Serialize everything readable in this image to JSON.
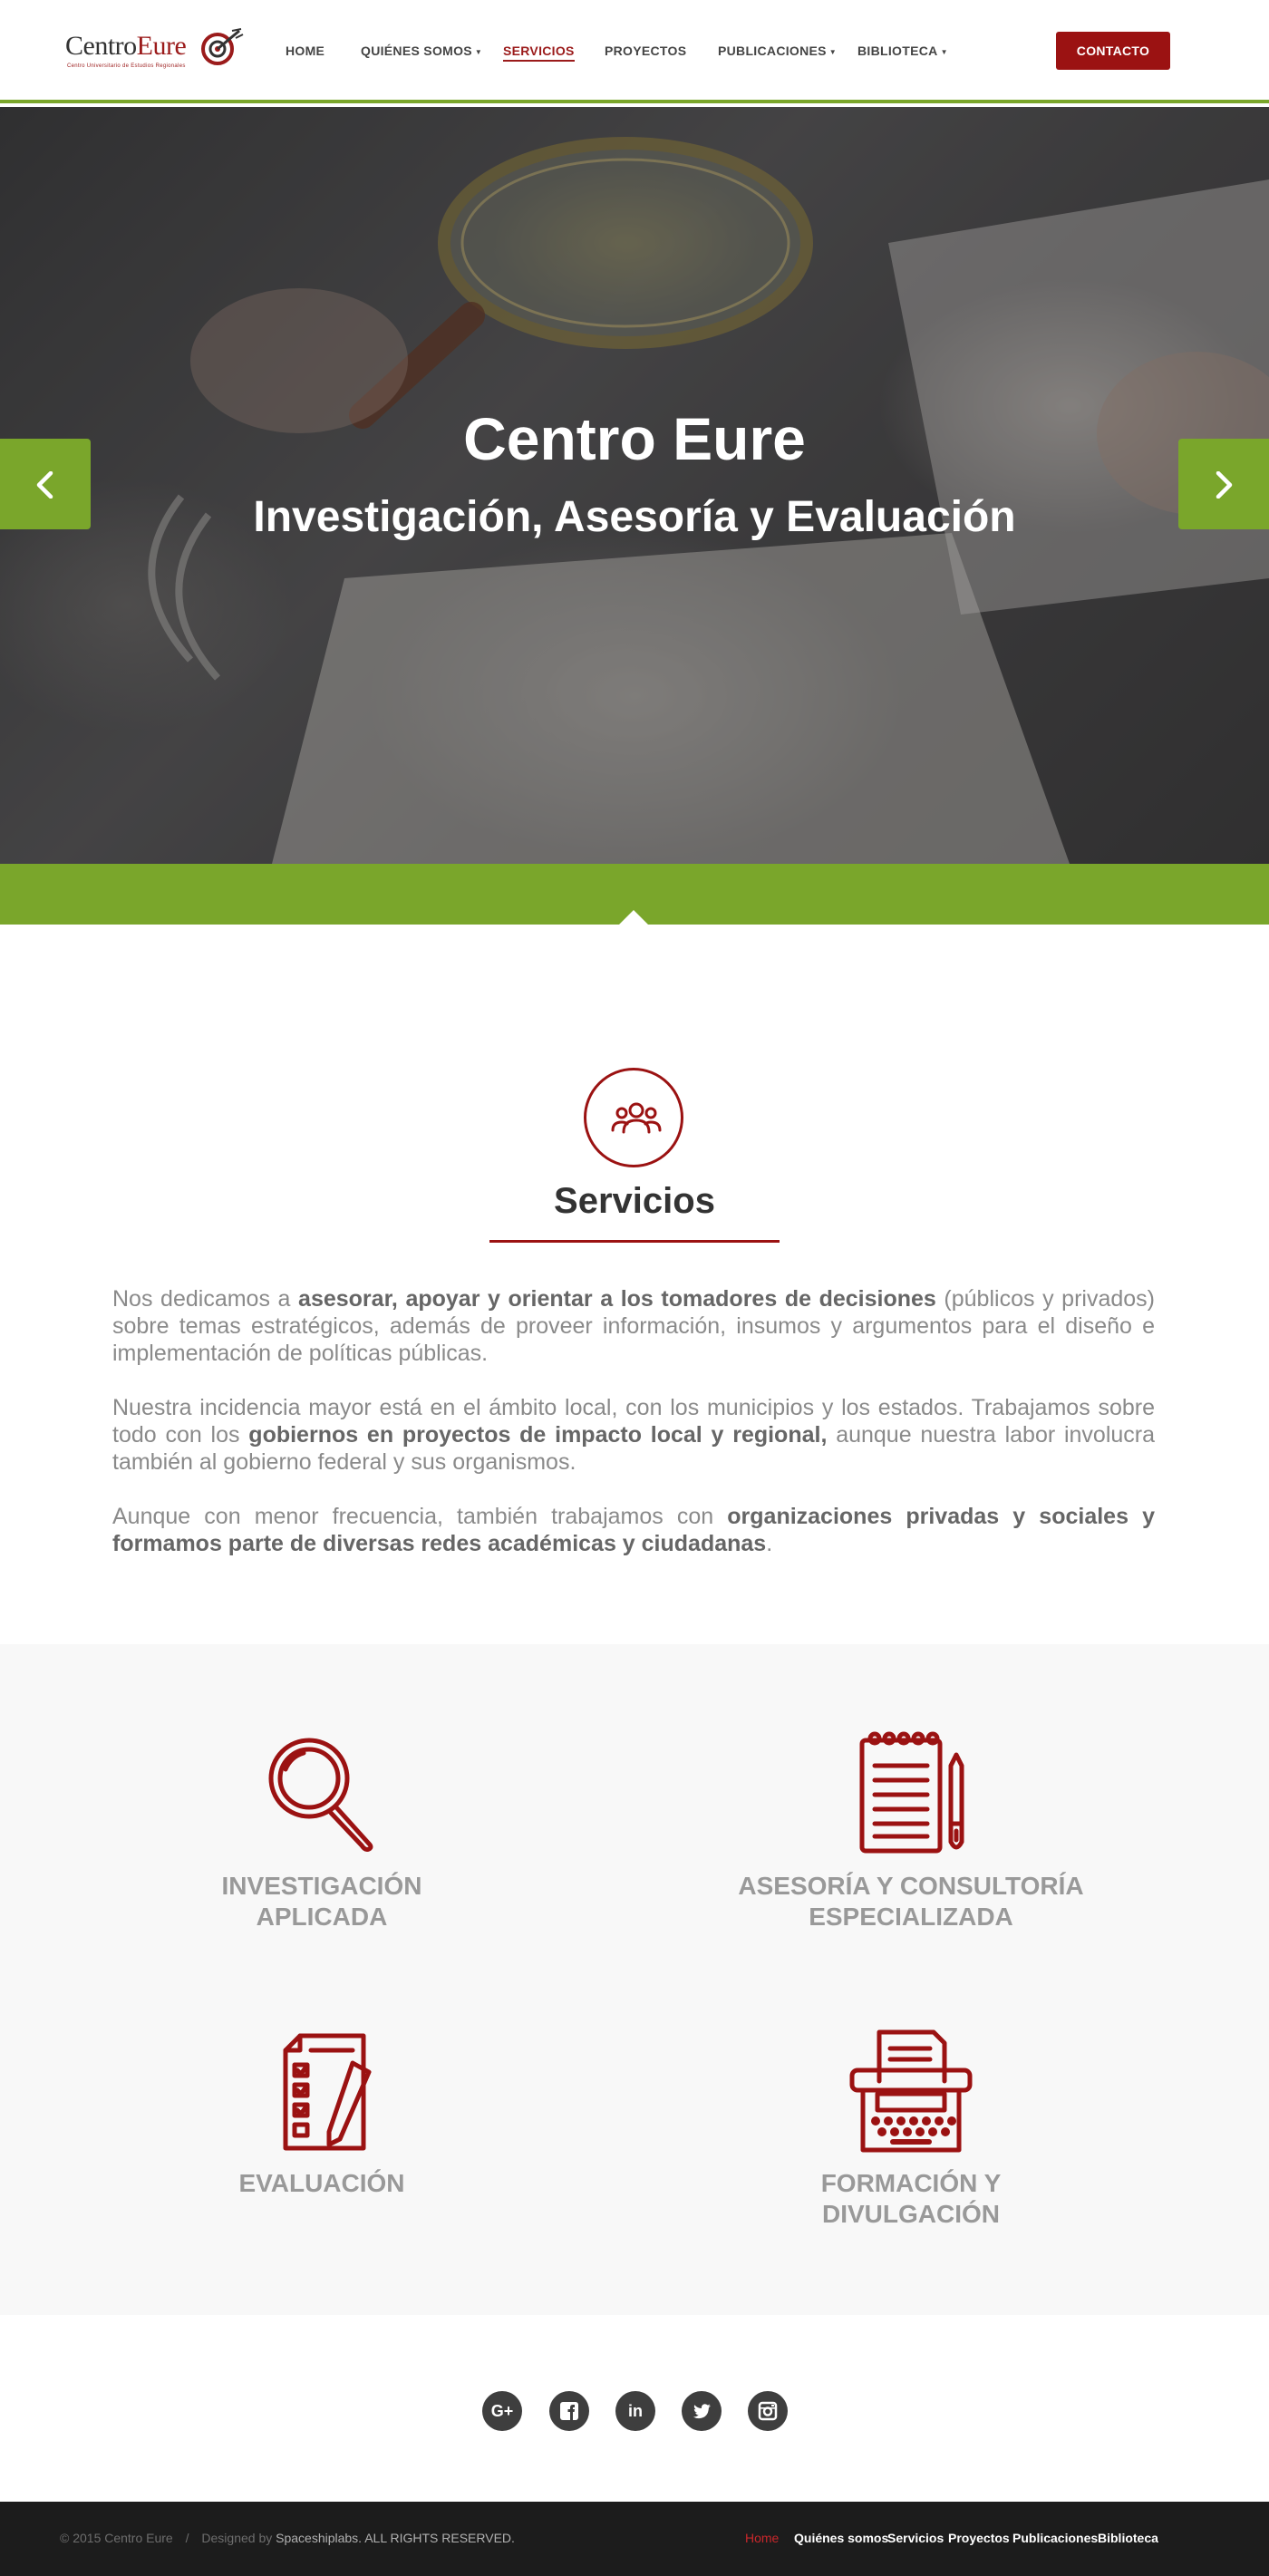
{
  "header": {
    "logo_text_a": "Centro",
    "logo_text_b": "Eure",
    "logo_sub": "Centro Universitario de Estudios Regionales",
    "nav": [
      {
        "label": "HOME",
        "dropdown": false,
        "active": false
      },
      {
        "label": "QUIÉNES SOMOS",
        "dropdown": true,
        "active": false
      },
      {
        "label": "SERVICIOS",
        "dropdown": false,
        "active": true
      },
      {
        "label": "PROYECTOS",
        "dropdown": false,
        "active": false
      },
      {
        "label": "PUBLICACIONES",
        "dropdown": true,
        "active": false
      },
      {
        "label": "BIBLIOTECA",
        "dropdown": true,
        "active": false
      }
    ],
    "contact_label": "CONTACTO"
  },
  "hero": {
    "title": "Centro Eure",
    "subtitle": "Investigación, Asesoría y Evaluación",
    "prev_icon": "chevron-left-icon",
    "next_icon": "chevron-right-icon"
  },
  "services_intro": {
    "icon": "people-group-icon",
    "heading": "Servicios",
    "p1": [
      {
        "t": "Nos dedicamos a ",
        "b": false
      },
      {
        "t": "asesorar, apoyar y orientar a los tomadores de decisiones",
        "b": true
      },
      {
        "t": " (públicos y privados) sobre temas estratégicos, además de proveer información, insumos y argumentos para el diseño e implementación de políticas públicas.",
        "b": false
      }
    ],
    "p2": [
      {
        "t": "Nuestra incidencia mayor está en el ámbito local, con los municipios y los estados. Trabajamos sobre todo con los ",
        "b": false
      },
      {
        "t": "gobiernos en proyectos de impacto local y regional,",
        "b": true
      },
      {
        "t": " aunque nuestra labor involucra también al gobierno federal y sus organismos.",
        "b": false
      }
    ],
    "p3": [
      {
        "t": "Aunque con menor frecuencia, también trabajamos con ",
        "b": false
      },
      {
        "t": "organizaciones privadas y sociales y formamos parte de diversas redes académicas y ciudadanas",
        "b": true
      },
      {
        "t": ".",
        "b": false
      }
    ]
  },
  "services": [
    {
      "label": "INVESTIGACIÓN\nAPLICADA",
      "icon": "magnifier-icon"
    },
    {
      "label": "ASESORÍA Y CONSULTORÍA\nESPECIALIZADA",
      "icon": "notepad-pen-icon"
    },
    {
      "label": "EVALUACIÓN",
      "icon": "checklist-pencil-icon"
    },
    {
      "label": "FORMACIÓN Y\nDIVULGACIÓN",
      "icon": "typewriter-icon"
    }
  ],
  "social": [
    {
      "name": "google-plus-icon",
      "glyph": "G+"
    },
    {
      "name": "facebook-icon",
      "glyph": "f"
    },
    {
      "name": "linkedin-icon",
      "glyph": "in"
    },
    {
      "name": "twitter-icon",
      "glyph": ""
    },
    {
      "name": "instagram-icon",
      "glyph": ""
    }
  ],
  "footer": {
    "copyright": "© 2015 Centro Eure",
    "separator": "/",
    "designed_by": "Designed by",
    "designer": "Spaceshiplabs.",
    "rights": "ALL RIGHTS RESERVED.",
    "nav": [
      {
        "label": "Home",
        "active": true
      },
      {
        "label": "Quiénes somos",
        "active": false
      },
      {
        "label": "Servicios",
        "active": false
      },
      {
        "label": "Proyectos",
        "active": false
      },
      {
        "label": "Publicaciones",
        "active": false
      },
      {
        "label": "Biblioteca",
        "active": false
      }
    ]
  },
  "colors": {
    "accent_red": "#9b1212",
    "accent_green": "#7aa62b",
    "footer_bg": "#1c1c1c"
  }
}
